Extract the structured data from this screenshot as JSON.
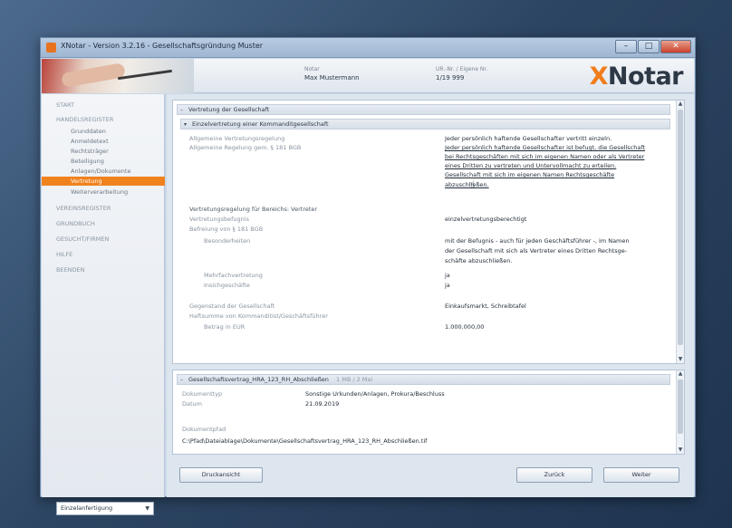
{
  "window": {
    "title": "XNotar - Version 3.2.16 - Gesellschaftsgründung Muster",
    "minimize": "–",
    "maximize": "□",
    "close": "✕"
  },
  "header": {
    "label1": "Notar",
    "value1": "Max Mustermann",
    "label2": "UR.-Nr. / Eigene Nr.",
    "value2": "1/19 999",
    "logo_x": "X",
    "logo_rest": "Notar"
  },
  "sidebar": {
    "items": [
      {
        "label": "START",
        "type": "main"
      },
      {
        "label": "HANDELSREGISTER",
        "type": "main"
      },
      {
        "label": "Grunddaten",
        "type": "sub"
      },
      {
        "label": "Anmeldetext",
        "type": "sub"
      },
      {
        "label": "Rechtsträger",
        "type": "sub"
      },
      {
        "label": "Beteiligung",
        "type": "sub"
      },
      {
        "label": "Anlagen/Dokumente",
        "type": "sub"
      },
      {
        "label": "Vertretung",
        "type": "sub",
        "active": true
      },
      {
        "label": "Weiterverarbeitung",
        "type": "sub"
      },
      {
        "label": "VEREINSREGISTER",
        "type": "main"
      },
      {
        "label": "GRUNDBUCH",
        "type": "main"
      },
      {
        "label": "GESUCHT/FIRMEN",
        "type": "main"
      },
      {
        "label": "HILFE",
        "type": "main"
      },
      {
        "label": "BEENDEN",
        "type": "main"
      }
    ],
    "select_value": "Einzelanfertigung",
    "select_arrow": "▼"
  },
  "panel1": {
    "section_title": "Vertretung der Gesellschaft",
    "subsection_title": "Einzelvertretung einer Kommanditgesellschaft",
    "rows": [
      {
        "label": "Allgemeine Vertretungsregelung",
        "value": "Jeder persönlich haftende Gesellschafter vertritt einzeln."
      },
      {
        "label": "Allgemeine Regelung gem. § 181 BGB",
        "value_lines": [
          "Jeder persönlich haftende Gesellschafter ist befugt, die Gesellschaft",
          "bei Rechtsgeschäften mit sich im eigenen Namen oder als Vertreter",
          "eines Dritten zu vertreten und Untervollmacht zu erteilen.",
          "Gesellschaft mit sich im eigenen Namen Rechtsgeschäfte",
          "abzuschließen."
        ]
      }
    ],
    "group_title": "Vertretungsregelung für Bereichs: Vertreter",
    "group_rows": [
      {
        "label": "Vertretungsbefugnis",
        "value": "einzelvertretungsberechtigt"
      },
      {
        "label": "Befreiung von § 181 BGB",
        "value": ""
      },
      {
        "label": "Besonderheiten",
        "value_lines": [
          "mit der Befugnis - auch für jeden Geschäftsführer -, im Namen",
          "der Gesellschaft mit sich als Vertreter eines Dritten Rechtsge-",
          "schäfte abzuschließen."
        ]
      },
      {
        "label": "Mehrfachvertretung",
        "value": "ja"
      },
      {
        "label": "Insichgeschäfte",
        "value": "ja"
      }
    ],
    "more_rows": [
      {
        "label": "Gegenstand der Gesellschaft",
        "value": "Einkaufsmarkt, Schreibtafel"
      },
      {
        "label": "Haftsumme von Kommanditist/Geschäftsführer",
        "value": ""
      },
      {
        "label": "Betrag in EUR",
        "value": "1.000.000,00"
      }
    ]
  },
  "panel2": {
    "section_title": "Gesellschaftsvertrag_HRA_123_RH_Abschließen",
    "section_meta": "1 MB / 2 Mai",
    "rows": [
      {
        "label": "Dokumenttyp",
        "value": "Sonstige Urkunden/Anlagen, Prokura/Beschluss"
      },
      {
        "label": "Datum",
        "value": "21.09.2019"
      }
    ],
    "file_label": "Dokumentpfad",
    "file_path": "C:\\Pfad\\Dateiablage\\Dokumente\\Gesellschaftsvertrag_HRA_123_RH_Abschließen.tif"
  },
  "buttons": {
    "print": "Druckansicht",
    "back": "Zurück",
    "next": "Weiter"
  }
}
